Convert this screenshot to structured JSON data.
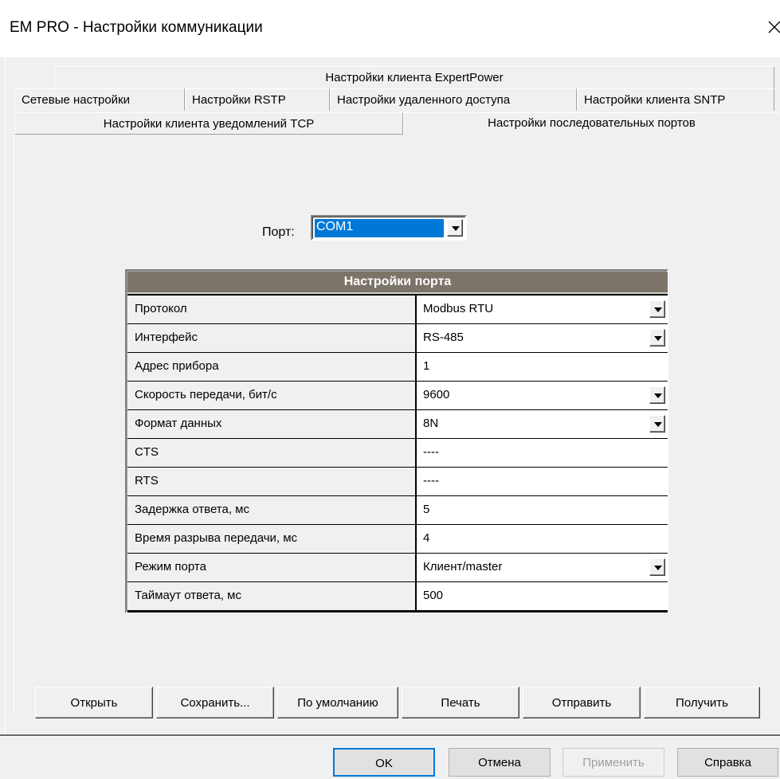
{
  "window": {
    "title": "EM PRO - Настройки коммуникации"
  },
  "tabs": {
    "row1": [
      "Настройки клиента ExpertPower"
    ],
    "row2": [
      "Сетевые настройки",
      "Настройки RSTP",
      "Настройки удаленного доступа",
      "Настройки клиента SNTP"
    ],
    "row3": [
      "Настройки клиента уведомлений TCP",
      "Настройки последовательных портов"
    ],
    "active": "Настройки последовательных портов"
  },
  "port": {
    "label": "Порт:",
    "value": "COM1"
  },
  "grid": {
    "header": "Настройки порта",
    "rows": [
      {
        "name": "Протокол",
        "value": "Modbus RTU",
        "dropdown": true
      },
      {
        "name": "Интерфейс",
        "value": "RS-485",
        "dropdown": true
      },
      {
        "name": "Адрес прибора",
        "value": "1",
        "dropdown": false
      },
      {
        "name": "Скорость передачи, бит/с",
        "value": "9600",
        "dropdown": true
      },
      {
        "name": "Формат данных",
        "value": "8N",
        "dropdown": true
      },
      {
        "name": "CTS",
        "value": "----",
        "dropdown": false
      },
      {
        "name": "RTS",
        "value": "----",
        "dropdown": false
      },
      {
        "name": "Задержка ответа, мс",
        "value": "5",
        "dropdown": false
      },
      {
        "name": "Время разрыва передачи, мс",
        "value": "4",
        "dropdown": false
      },
      {
        "name": "Режим порта",
        "value": "Клиент/master",
        "dropdown": true
      },
      {
        "name": "Таймаут ответа, мс",
        "value": "500",
        "dropdown": false
      }
    ]
  },
  "actions": {
    "open": "Открыть",
    "save": "Сохранить...",
    "defaults": "По умолчанию",
    "print": "Печать",
    "send": "Отправить",
    "receive": "Получить"
  },
  "dialog": {
    "ok": "OK",
    "cancel": "Отмена",
    "apply": "Применить",
    "help": "Справка"
  }
}
